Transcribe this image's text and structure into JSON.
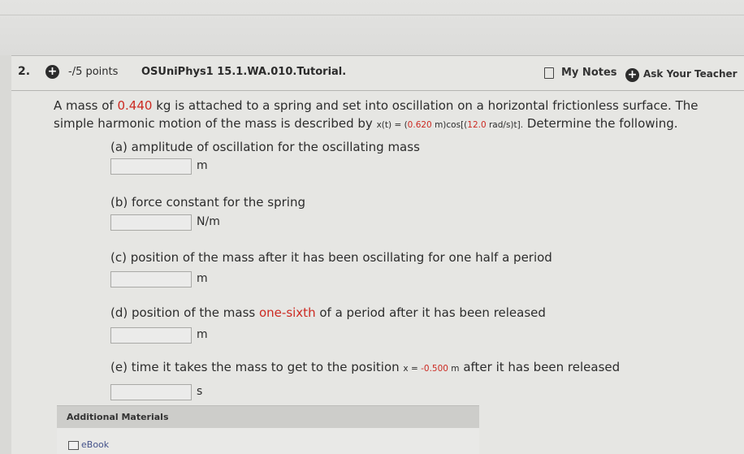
{
  "question": {
    "number": "2.",
    "points": "-/5 points",
    "id": "OSUniPhys1 15.1.WA.010.Tutorial.",
    "my_notes": "My Notes",
    "ask_teacher": "Ask Your Teacher"
  },
  "problem": {
    "text1": "A mass of ",
    "mass": "0.440",
    "text2": " kg is attached to a spring and set into oscillation on a horizontal frictionless surface. The simple harmonic motion of the mass is described by ",
    "eq_a": "x(t) = (",
    "eq_amp": "0.620",
    "eq_b": " m)cos[(",
    "eq_omega": "12.0",
    "eq_c": " rad/s)t].",
    "text3": " Determine the following."
  },
  "parts": [
    {
      "label": "(a) amplitude of oscillation for the oscillating mass",
      "unit": "m"
    },
    {
      "label": "(b) force constant for the spring",
      "unit": "N/m"
    },
    {
      "label": "(c) position of the mass after it has been oscillating for one half a period",
      "unit": "m"
    },
    {
      "label_pre": "(d) position of the mass ",
      "label_red": "one-sixth",
      "label_post": " of a period after it has been released",
      "unit": "m"
    },
    {
      "label_pre": "(e) time it takes the mass to get to the position ",
      "eq_pre": "x = ",
      "eq_val": "-0.500",
      "eq_post": " m",
      "label_post": " after it has been released",
      "unit": "s"
    }
  ],
  "materials": {
    "header": "Additional Materials",
    "ebook": "eBook"
  }
}
